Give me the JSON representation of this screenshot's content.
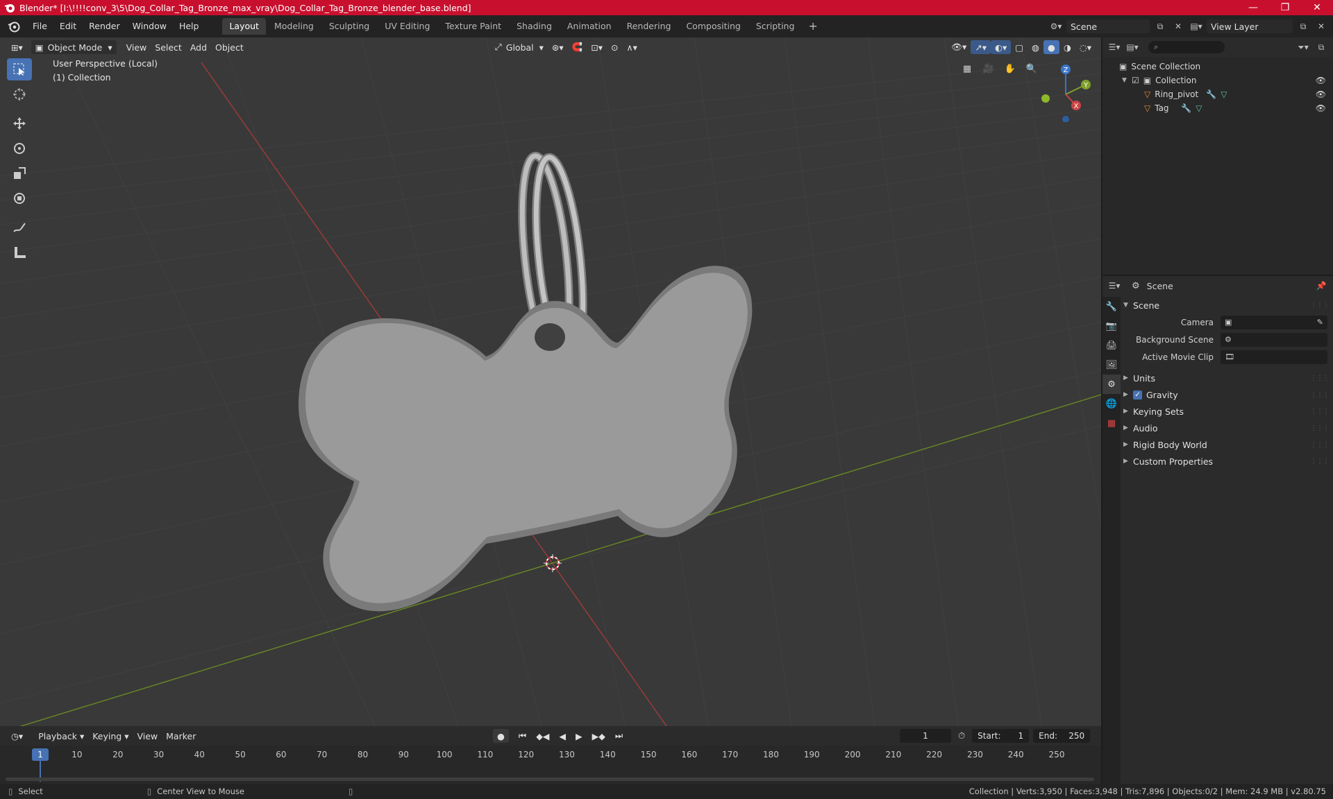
{
  "window": {
    "title": "Blender* [I:\\!!!!conv_3\\5\\Dog_Collar_Tag_Bronze_max_vray\\Dog_Collar_Tag_Bronze_blender_base.blend]",
    "minimize": "—",
    "maximize": "❐",
    "close": "✕"
  },
  "menu": [
    "File",
    "Edit",
    "Render",
    "Window",
    "Help"
  ],
  "workspaces": [
    "Layout",
    "Modeling",
    "Sculpting",
    "UV Editing",
    "Texture Paint",
    "Shading",
    "Animation",
    "Rendering",
    "Compositing",
    "Scripting"
  ],
  "active_workspace": "Layout",
  "add_workspace": "+",
  "scene_name": "Scene",
  "view_layer": "View Layer",
  "viewport": {
    "mode": "Object Mode",
    "menus": [
      "View",
      "Select",
      "Add",
      "Object"
    ],
    "transform_orientation": "Global",
    "perspective_label": "User Perspective (Local)",
    "collection_label": "(1) Collection",
    "gizmo": {
      "z": "Z",
      "y": "Y",
      "x": "X"
    }
  },
  "outliner": {
    "root": "Scene Collection",
    "collection": "Collection",
    "objects": [
      "Ring_pivot",
      "Tag"
    ]
  },
  "properties": {
    "header": "Scene",
    "section": "Scene",
    "fields": [
      {
        "label": "Camera",
        "value": ""
      },
      {
        "label": "Background Scene",
        "value": ""
      },
      {
        "label": "Active Movie Clip",
        "value": ""
      }
    ],
    "subsections": [
      "Units",
      "Gravity",
      "Keying Sets",
      "Audio",
      "Rigid Body World",
      "Custom Properties"
    ],
    "gravity_enabled": true
  },
  "timeline": {
    "menus": [
      "Playback",
      "Keying",
      "View",
      "Marker"
    ],
    "current_frame": "1",
    "start_label": "Start:",
    "start": "1",
    "end_label": "End:",
    "end": "250",
    "ruler_frames": [
      1,
      10,
      20,
      30,
      40,
      50,
      60,
      70,
      80,
      90,
      100,
      110,
      120,
      130,
      140,
      150,
      160,
      170,
      180,
      190,
      200,
      210,
      220,
      230,
      240,
      250
    ]
  },
  "status": {
    "select": "Select",
    "center_view": "Center View to Mouse",
    "stats": "Collection | Verts:3,950 | Faces:3,948 | Tris:7,896 | Objects:0/2 | Mem: 24.9 MB | v2.80.75"
  },
  "colors": {
    "title_bar": "#c8102e",
    "accent": "#4772b3",
    "object_orange": "#e38b35",
    "axis_x": "#c94444",
    "axis_y": "#7fa02a",
    "axis_z": "#3a76c8"
  }
}
